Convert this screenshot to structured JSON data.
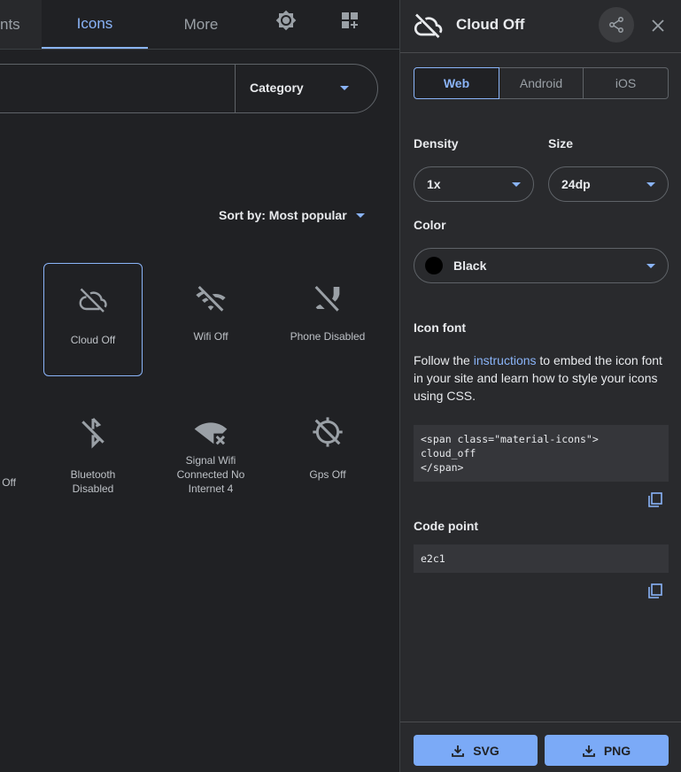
{
  "nav": {
    "tabs": [
      {
        "label": "nts"
      },
      {
        "label": "Icons",
        "active": true
      },
      {
        "label": "More"
      }
    ],
    "icons": [
      "brightness-icon",
      "dashboard-add-icon"
    ]
  },
  "search": {
    "category_label": "Category"
  },
  "sort": {
    "label": "Sort by: Most popular"
  },
  "grid": {
    "items": [
      {
        "label": "Cloud Off",
        "icon": "cloud-off-icon",
        "selected": true
      },
      {
        "label": "Wifi Off",
        "icon": "wifi-off-icon"
      },
      {
        "label": "Phone Disabled",
        "icon": "phone-disabled-icon"
      },
      {
        "label": "Off",
        "icon": ""
      },
      {
        "label": "Bluetooth Disabled",
        "icon": "bluetooth-disabled-icon"
      },
      {
        "label": "Signal Wifi Connected No Internet 4",
        "icon": "signal-wifi-no-internet-icon"
      },
      {
        "label": "Gps Off",
        "icon": "gps-off-icon"
      }
    ]
  },
  "panel": {
    "title": "Cloud Off",
    "platform_tabs": [
      {
        "label": "Web",
        "active": true
      },
      {
        "label": "Android"
      },
      {
        "label": "iOS"
      }
    ],
    "density_label": "Density",
    "density_value": "1x",
    "size_label": "Size",
    "size_value": "24dp",
    "color_label": "Color",
    "color_value": "Black",
    "color_swatch": "#000000",
    "icon_font_label": "Icon font",
    "desc_pre": "Follow the ",
    "desc_link": "instructions",
    "desc_post": " to embed the icon font in your site and learn how to style your icons using CSS.",
    "code_snippet": "<span class=\"material-icons\">\ncloud_off\n</span>",
    "code_point_label": "Code point",
    "code_point": "e2c1",
    "svg_button": "SVG",
    "png_button": "PNG"
  },
  "colors": {
    "accent": "#8ab4f8",
    "button": "#7baaf7",
    "bg": "#202124",
    "panel": "#292a2d"
  }
}
